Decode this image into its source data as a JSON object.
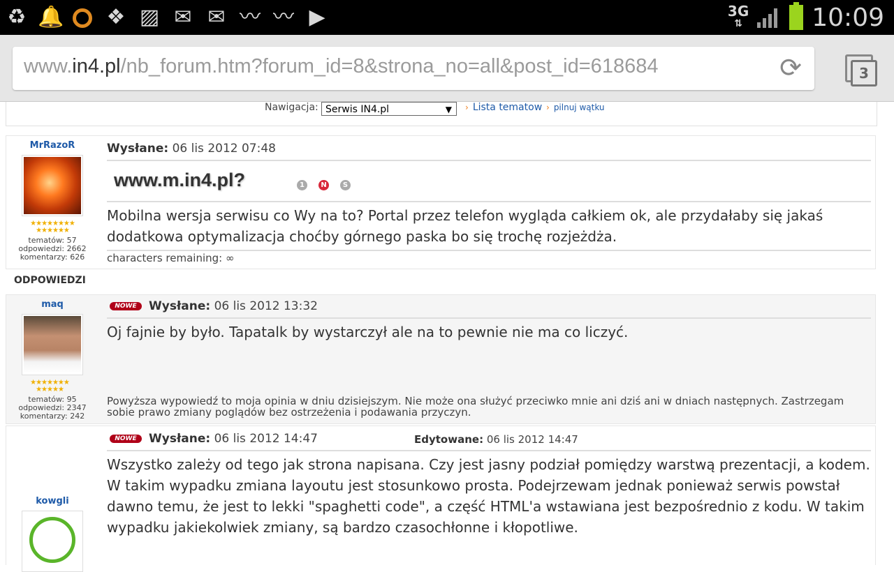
{
  "status_bar": {
    "left_icons": [
      "recycle-icon",
      "bell-icon",
      "circle-app-icon",
      "dropbox-icon",
      "image-icon",
      "gmail-icon",
      "email-icon",
      "pulse-icon",
      "pulse-icon",
      "play-store-icon"
    ],
    "network": "3G",
    "time": "10:09",
    "colors": {
      "battery": "#9bd41e"
    }
  },
  "browser": {
    "url_prefix": "www.",
    "url_domain": "in4.pl",
    "url_path": "/nb_forum.htm?forum_id=8&strona_no=all&post_id=618684",
    "tab_count": "3"
  },
  "nav": {
    "label": "Nawigacja:",
    "selected": "Serwis IN4.pl",
    "link1": "Lista tematow",
    "link2": "pilnuj wątku"
  },
  "section_label": "ODPOWIEDZI",
  "posts": [
    {
      "author": "MrRazoR",
      "stars": "★★★★★★★★★★★★★★",
      "stats": [
        "tematów: 57",
        "odpowiedzi: 2662",
        "komentarzy: 626"
      ],
      "sent_label": "Wysłane:",
      "sent_date": "06 lis 2012 07:48",
      "title": "www.m.in4.pl?",
      "icons": [
        "1",
        "N",
        "S"
      ],
      "text": "Mobilna wersja serwisu co Wy na to? Portal przez telefon wygląda całkiem ok, ale przydałaby się jakaś dodatkowa optymalizacja choćby górnego paska bo się trochę rozjeżdża.",
      "footer": "characters remaining: ∞"
    },
    {
      "author": "maq",
      "stars": "★★★★★★★★★★★★",
      "stats": [
        "tematów: 95",
        "odpowiedzi: 2347",
        "komentarzy: 242"
      ],
      "badge": "NOWE",
      "sent_label": "Wysłane:",
      "sent_date": "06 lis 2012 13:32",
      "text": "Oj fajnie by było. Tapatalk by wystarczył ale na to pewnie nie ma co liczyć.",
      "signature": "Powyższa wypowiedź to moja opinia w dniu dzisiejszym. Nie może ona służyć przeciwko mnie ani dziś ani w dniach następnych. Zastrzegam sobie prawo zmiany poglądów bez ostrzeżenia i podawania przyczyn."
    },
    {
      "author": "kowgli",
      "badge": "NOWE",
      "sent_label": "Wysłane:",
      "sent_date": "06 lis 2012 14:47",
      "edited_label": "Edytowane:",
      "edited_date": "06 lis 2012 14:47",
      "text": "Wszystko zależy od tego jak strona napisana. Czy jest jasny podział pomiędzy warstwą prezentacji, a kodem. W takim wypadku zmiana layoutu jest stosunkowo prosta. Podejrzewam jednak ponieważ serwis powstał dawno temu, że jest to lekki \"spaghetti code\", a część HTML'a wstawiana jest bezpośrednio z kodu. W takim wypadku jakiekolwiek zmiany, są bardzo czasochłonne i kłopotliwe."
    }
  ]
}
